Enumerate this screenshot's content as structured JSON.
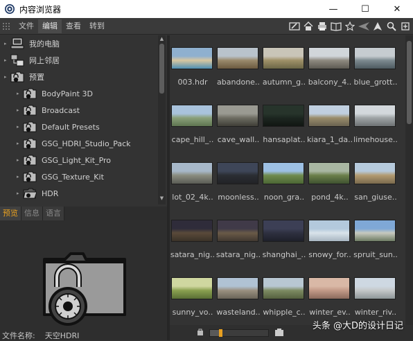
{
  "window": {
    "title": "内容浏览器",
    "minimize_glyph": "—",
    "maximize_glyph": "☐",
    "close_glyph": "✕"
  },
  "menu": {
    "items": [
      "文件",
      "编辑",
      "查看",
      "转到"
    ],
    "active_index": 1
  },
  "toolbar_icons": [
    "pencil-icon",
    "home-icon",
    "printer-icon",
    "book-icon",
    "star-icon",
    "back-icon",
    "up-icon",
    "search-icon",
    "more-icon"
  ],
  "tree": {
    "items": [
      {
        "label": "我的电脑",
        "icon": "computer-icon",
        "indent": 0
      },
      {
        "label": "网上邻居",
        "icon": "network-icon",
        "indent": 0
      },
      {
        "label": "预置",
        "icon": "folder-lock-icon",
        "indent": 0
      },
      {
        "label": "BodyPaint 3D",
        "icon": "folder-lock-icon",
        "indent": 1
      },
      {
        "label": "Broadcast",
        "icon": "folder-lock-icon",
        "indent": 1
      },
      {
        "label": "Default Presets",
        "icon": "folder-lock-icon",
        "indent": 1
      },
      {
        "label": "GSG_HDRI_Studio_Pack",
        "icon": "folder-lock-icon",
        "indent": 1
      },
      {
        "label": "GSG_Light_Kit_Pro",
        "icon": "folder-lock-icon",
        "indent": 1
      },
      {
        "label": "GSG_Texture_Kit",
        "icon": "folder-lock-icon",
        "indent": 1
      },
      {
        "label": "HDR",
        "icon": "folder-open-icon",
        "indent": 1
      }
    ]
  },
  "tabs": {
    "items": [
      "预览",
      "信息",
      "语言"
    ],
    "active_index": 0
  },
  "preview": {
    "filename_label": "文件名称:",
    "filename_value": "天空HDRI"
  },
  "thumbnails": [
    {
      "label": "003.hdr",
      "colors": [
        "#8fb0cf",
        "#d8c7a0",
        "#4d8fb3"
      ]
    },
    {
      "label": "abandone..",
      "colors": [
        "#b9c3cc",
        "#9a8a6c",
        "#6b5a3f"
      ]
    },
    {
      "label": "autumn_g..",
      "colors": [
        "#c9c5b8",
        "#9f9168",
        "#6c6647"
      ]
    },
    {
      "label": "balcony_4..",
      "colors": [
        "#d1d6da",
        "#8e8a80",
        "#5d5a52"
      ]
    },
    {
      "label": "blue_grott..",
      "colors": [
        "#c6ccd0",
        "#7d8a90",
        "#4d5a60"
      ]
    },
    {
      "label": "cape_hill_..",
      "colors": [
        "#a9c3dc",
        "#8aa07a",
        "#5e7550"
      ]
    },
    {
      "label": "cave_wall..",
      "colors": [
        "#9a9a92",
        "#6e6d63",
        "#3f3e37"
      ]
    },
    {
      "label": "hansaplat..",
      "colors": [
        "#27342b",
        "#1c2620",
        "#111612"
      ]
    },
    {
      "label": "kiara_1_da..",
      "colors": [
        "#c0cfe0",
        "#9a8d6c",
        "#6a6250"
      ]
    },
    {
      "label": "limehouse..",
      "colors": [
        "#d3d8dc",
        "#9fa4a6",
        "#6e7274"
      ]
    },
    {
      "label": "lot_02_4k..",
      "colors": [
        "#a7b8c9",
        "#8a8c80",
        "#5a5c55"
      ]
    },
    {
      "label": "moonless..",
      "colors": [
        "#3e4658",
        "#2a2d33",
        "#222326"
      ]
    },
    {
      "label": "noon_gra..",
      "colors": [
        "#9dc0e4",
        "#6f8b4e",
        "#4b6634"
      ]
    },
    {
      "label": "pond_4k..",
      "colors": [
        "#a9b7a2",
        "#6b7f4a",
        "#3f5230"
      ]
    },
    {
      "label": "san_giuse..",
      "colors": [
        "#b6cadc",
        "#b29a70",
        "#7a6a4c"
      ]
    },
    {
      "label": "satara_nig..",
      "colors": [
        "#2f2c3a",
        "#5a4a3a",
        "#3a3228"
      ]
    },
    {
      "label": "satara_nig..",
      "colors": [
        "#403a48",
        "#6a5a48",
        "#403830"
      ]
    },
    {
      "label": "shanghai_..",
      "colors": [
        "#3c3f55",
        "#2e3040",
        "#1e2029"
      ]
    },
    {
      "label": "snowy_for..",
      "colors": [
        "#b3c9dc",
        "#d9e3ea",
        "#a7b5c0"
      ]
    },
    {
      "label": "spruit_sun..",
      "colors": [
        "#7fa8d6",
        "#c7c9bf",
        "#6c7a62"
      ]
    },
    {
      "label": "sunny_vo..",
      "colors": [
        "#cfd7a0",
        "#8aa050",
        "#5a6f35"
      ]
    },
    {
      "label": "wasteland..",
      "colors": [
        "#b0c2d4",
        "#9a9080",
        "#6a6458"
      ]
    },
    {
      "label": "whipple_c..",
      "colors": [
        "#b8c7d2",
        "#7d8b62",
        "#55603f"
      ]
    },
    {
      "label": "winter_ev..",
      "colors": [
        "#d9b8a6",
        "#c29a88",
        "#8c6a5c"
      ]
    },
    {
      "label": "winter_riv..",
      "colors": [
        "#ced8e2",
        "#c4c7c8",
        "#8e9698"
      ]
    }
  ],
  "zoom": {
    "value": 0.15
  },
  "watermark": "头条 @大D的设计日记",
  "colors": {
    "accent": "#e8a020",
    "panel": "#333333",
    "title_bg": "#ffffff"
  }
}
